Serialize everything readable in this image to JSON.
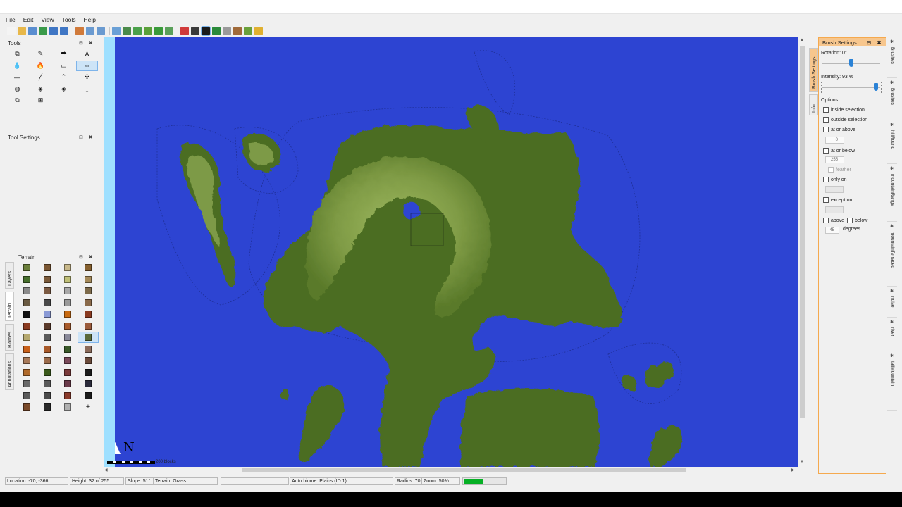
{
  "menu": [
    "File",
    "Edit",
    "View",
    "Tools",
    "Help"
  ],
  "toolbar_icons": [
    "new-icon",
    "open-icon",
    "save-icon",
    "export-icon",
    "undo-icon",
    "redo-icon",
    "zoom-in-icon",
    "zoom-reset-icon",
    "zoom-out-icon",
    "dimension-icon",
    "rotate-icon",
    "move-icon",
    "add-icon",
    "grid-icon",
    "expand-icon",
    "crosshair-icon",
    "center-icon",
    "target-icon",
    "layers-icon",
    "view-icon",
    "biome-icon",
    "globe-icon",
    "sun-icon"
  ],
  "tools_panel": {
    "title": "Tools",
    "controls": "⊟ ✖",
    "buttons": [
      {
        "name": "copy-tool",
        "glyph": "⧉"
      },
      {
        "name": "pencil-tool",
        "glyph": "✎"
      },
      {
        "name": "flood-tool",
        "glyph": "⮫"
      },
      {
        "name": "text-tool",
        "glyph": "A"
      },
      {
        "name": "water-tool",
        "glyph": "💧"
      },
      {
        "name": "lava-tool",
        "glyph": "🔥"
      },
      {
        "name": "sponge-tool",
        "glyph": "▭"
      },
      {
        "name": "raise-lower-tool",
        "glyph": "⇔"
      },
      {
        "name": "flatten-tool",
        "glyph": "—"
      },
      {
        "name": "smooth-tool",
        "glyph": "╱"
      },
      {
        "name": "raise-mountain-tool",
        "glyph": "⌃"
      },
      {
        "name": "set-spawn-tool",
        "glyph": "✣"
      },
      {
        "name": "pyramid-tool",
        "glyph": "◍"
      },
      {
        "name": "raise-pyramid-tool",
        "glyph": "◈"
      },
      {
        "name": "raise-rotate-tool",
        "glyph": "◈"
      },
      {
        "name": "selection-tool",
        "glyph": "⬚"
      },
      {
        "name": "copy-selection-tool",
        "glyph": "⧉"
      },
      {
        "name": "edit-selection-tool",
        "glyph": "⊞"
      }
    ]
  },
  "tool_settings": {
    "title": "Tool Settings",
    "controls": "⊟ ✖"
  },
  "terrain_panel": {
    "title": "Terrain",
    "controls": "⊟ ✖",
    "tabs": [
      "Layers",
      "Terrain",
      "Biomes",
      "Annotations"
    ]
  },
  "terrain_swatches": [
    [
      "#6b7f3b",
      "#7a5632",
      "#c8b88a",
      "#86602e"
    ],
    [
      "#466e2c",
      "#7a5a3a",
      "#bfbf78",
      "#a58a5a"
    ],
    [
      "#8a8a8a",
      "#7b5a42",
      "#a8a8a8",
      "#7d6a4a"
    ],
    [
      "#6a5a42",
      "#4a4a4a",
      "#9a9a9a",
      "#8a6a4a"
    ],
    [
      "#111111",
      "#8a9ad6",
      "#c86a10",
      "#8a3a20"
    ],
    [
      "#8a3a20",
      "#5a3a2a",
      "#a85a2a",
      "#9a5a3a"
    ],
    [
      "#b5a86e",
      "#5a5a5a",
      "#8a8a9a",
      "#5a6a3a"
    ],
    [
      "#c8601a",
      "#a85a2a",
      "#3a5a2a",
      "#8a6a5a"
    ],
    [
      "#a87a5a",
      "#9a6a4a",
      "#7a4a5a",
      "#6a4a3a"
    ],
    [
      "#b06a2a",
      "#3a5a1a",
      "#7a3a3a",
      "#1a1a1a"
    ],
    [
      "#6a6a6a",
      "#5a5a5a",
      "#6a3a4a",
      "#2a2a3a"
    ],
    [
      "#5a5a5a",
      "#4a4a4a",
      "#8a3a2a",
      "#1a1a1a"
    ],
    [
      "#7a4a2a",
      "#2a2a2a",
      "#b0b0b0",
      "plus"
    ]
  ],
  "map": {
    "compass_label": "N",
    "scale_label": "200 blocks",
    "water_color": "#2d44d2",
    "land_color": "#4c6d21",
    "mountain_color": "#7b9a43"
  },
  "brush_settings": {
    "title": "Brush Settings",
    "controls": "⊟ ✖",
    "rotation_label": "Rotation: 0°",
    "rotation_fraction": 0.5,
    "intensity_label": "Intensity: 93 %",
    "intensity_fraction": 0.93,
    "options_label": "Options",
    "inside_selection": "inside selection",
    "outside_selection": "outside selection",
    "at_or_above": "at or above",
    "at_or_above_value": "0",
    "at_or_below": "at or below",
    "at_or_below_value": "255",
    "feather": "feather",
    "only_on": "only on",
    "except_on": "except on",
    "above": "above",
    "below": "below",
    "degrees_value": "45",
    "degrees": "degrees",
    "left_tabs": [
      "Brush Settings",
      "Info"
    ]
  },
  "right_tabs": [
    "Brushes",
    "Brushes",
    "hillRound",
    "mountainRange",
    "mountainTerraced",
    "noise",
    "river",
    "tallMountain"
  ],
  "status": {
    "location": "Location: -70, -366",
    "height": "Height: 32 of 255",
    "slope": "Slope: 51°",
    "terrain": "Terrain: Grass",
    "empty": "",
    "biome": "Auto biome: Plains (ID 1)",
    "radius": "Radius: 70",
    "zoom": "Zoom: 50%",
    "progress_fraction": 0.45
  }
}
